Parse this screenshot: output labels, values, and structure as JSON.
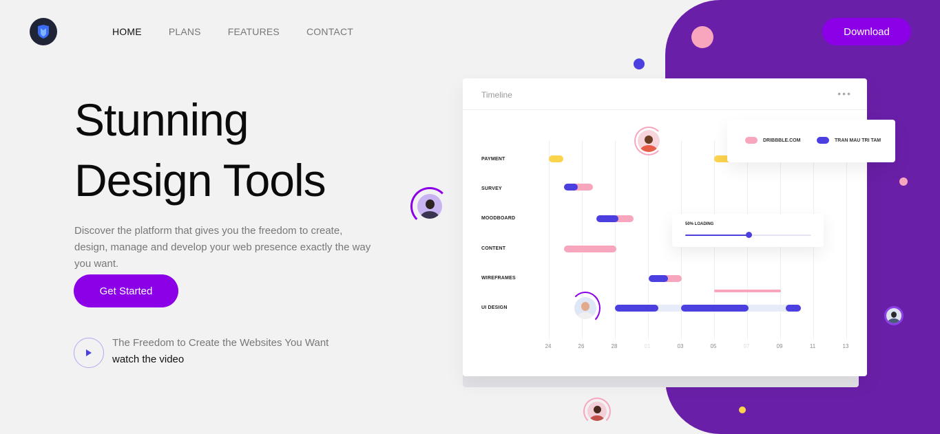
{
  "nav": {
    "logo_icon": "shield-logo-icon",
    "items": [
      {
        "label": "HOME",
        "active": true
      },
      {
        "label": "PLANS",
        "active": false
      },
      {
        "label": "FEATURES",
        "active": false
      },
      {
        "label": "CONTACT",
        "active": false
      }
    ],
    "download_label": "Download"
  },
  "hero": {
    "title_line1": "Stunning",
    "title_line2": "Design Tools",
    "description": "Discover the platform that gives you the freedom to create, design, manage and develop your web presence exactly the way you want.",
    "cta_label": "Get Started",
    "video_title": "The Freedom to Create the Websites You Want",
    "video_link": "watch the video",
    "play_icon": "play-icon"
  },
  "timeline": {
    "title": "Timeline",
    "menu_icon": "more-dots-icon",
    "rows": [
      {
        "label": "PAYMENT"
      },
      {
        "label": "SURVEY"
      },
      {
        "label": "MOODBOARD"
      },
      {
        "label": "CONTENT"
      },
      {
        "label": "WIREFRAMES"
      },
      {
        "label": "UI DESIGN"
      }
    ],
    "ticks": [
      {
        "label": "24",
        "muted": false
      },
      {
        "label": "26",
        "muted": false
      },
      {
        "label": "28",
        "muted": false
      },
      {
        "label": "01",
        "muted": true
      },
      {
        "label": "03",
        "muted": false
      },
      {
        "label": "05",
        "muted": false
      },
      {
        "label": "07",
        "muted": true
      },
      {
        "label": "09",
        "muted": false
      },
      {
        "label": "11",
        "muted": false
      },
      {
        "label": "13",
        "muted": false
      }
    ],
    "legend": [
      {
        "label": "DRIBBBLE.COM",
        "color": "#f7a6bd"
      },
      {
        "label": "TRAN MAU TRI TAM",
        "color": "#4b3fe0"
      }
    ],
    "loading": {
      "label": "50% LOADING",
      "progress": 0.5
    }
  },
  "colors": {
    "accent": "#8b00e6",
    "panel": "#6a1fa8",
    "blue": "#4b3fe0",
    "pink": "#f7a6bd",
    "yellow": "#fcd34d"
  }
}
